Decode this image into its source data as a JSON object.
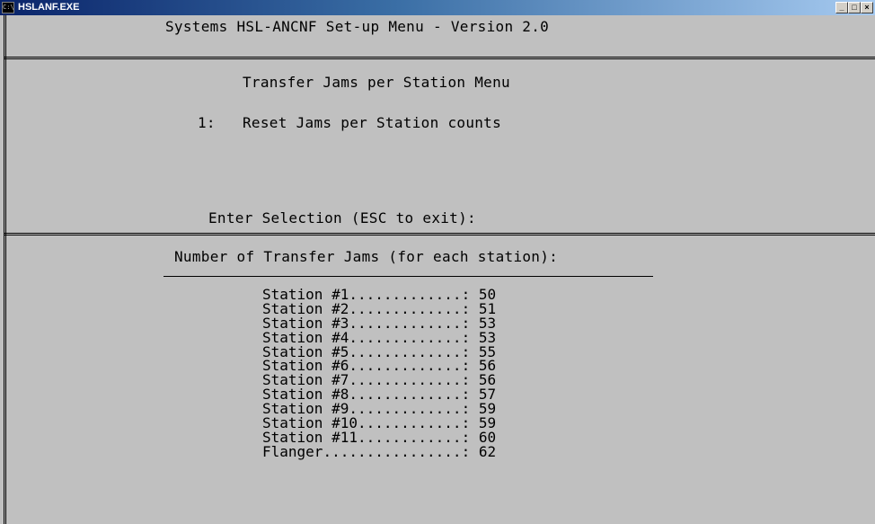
{
  "window": {
    "title": "HSLANF.EXE",
    "icon": "console-icon",
    "icon_glyph": "C:\\",
    "buttons": {
      "minimize": "_",
      "maximize": "□",
      "close": "×"
    }
  },
  "header": {
    "title": "Systems HSL-ANCNF Set-up Menu - Version 2.0"
  },
  "menu": {
    "heading": "Transfer Jams per Station Menu",
    "options": [
      {
        "key": "1:",
        "label": "Reset Jams per Station counts"
      }
    ],
    "prompt": "Enter Selection (ESC to exit):"
  },
  "jams": {
    "heading": "Number of Transfer Jams (for each station):",
    "rows": [
      {
        "label": "Station #1",
        "dots": ".............",
        "value": "50"
      },
      {
        "label": "Station #2",
        "dots": ".............",
        "value": "51"
      },
      {
        "label": "Station #3",
        "dots": ".............",
        "value": "53"
      },
      {
        "label": "Station #4",
        "dots": ".............",
        "value": "53"
      },
      {
        "label": "Station #5",
        "dots": ".............",
        "value": "55"
      },
      {
        "label": "Station #6",
        "dots": ".............",
        "value": "56"
      },
      {
        "label": "Station #7",
        "dots": ".............",
        "value": "56"
      },
      {
        "label": "Station #8",
        "dots": ".............",
        "value": "57"
      },
      {
        "label": "Station #9",
        "dots": ".............",
        "value": "59"
      },
      {
        "label": "Station #10",
        "dots": "............",
        "value": "59"
      },
      {
        "label": "Station #11",
        "dots": "............",
        "value": "60"
      },
      {
        "label": "Flanger",
        "dots": "................",
        "value": "62"
      }
    ]
  },
  "colors": {
    "background": "#c0c0c0",
    "text": "#000000",
    "titlebar_start": "#0a246a",
    "titlebar_end": "#a6caf0"
  }
}
